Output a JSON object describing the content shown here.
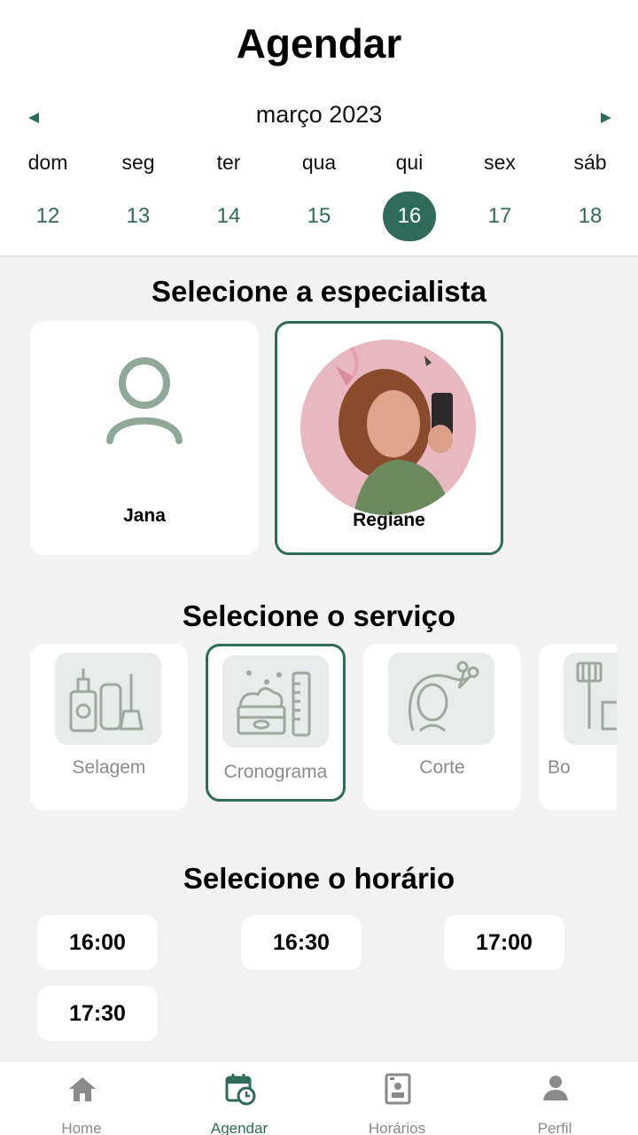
{
  "header": {
    "title": "Agendar",
    "month": "março 2023",
    "weekdays": [
      "dom",
      "seg",
      "ter",
      "qua",
      "qui",
      "sex",
      "sáb"
    ],
    "days": [
      "12",
      "13",
      "14",
      "15",
      "16",
      "17",
      "18"
    ],
    "selected_day": "16"
  },
  "specialists": {
    "title": "Selecione a especialista",
    "items": [
      {
        "name": "Jana",
        "icon": "user-outline-icon",
        "selected": false
      },
      {
        "name": "Regiane",
        "icon": "profile-photo",
        "selected": true
      }
    ]
  },
  "services": {
    "title": "Selecione o serviço",
    "items": [
      {
        "label": "Selagem",
        "icon": "hair-products-icon",
        "selected": false
      },
      {
        "label": "Cronograma",
        "icon": "cream-jar-comb-icon",
        "selected": true
      },
      {
        "label": "Corte",
        "icon": "woman-scissors-icon",
        "selected": false
      },
      {
        "label": "Bo",
        "icon": "dye-brush-icon",
        "selected": false
      }
    ]
  },
  "times": {
    "title": "Selecione o horário",
    "items": [
      "16:00",
      "16:30",
      "17:00",
      "17:30"
    ]
  },
  "nav": {
    "items": [
      {
        "label": "Home",
        "icon": "home-icon"
      },
      {
        "label": "Agendar",
        "icon": "calendar-clock-icon"
      },
      {
        "label": "Horários",
        "icon": "schedule-card-icon"
      },
      {
        "label": "Perfil",
        "icon": "person-icon"
      }
    ],
    "active": "Agendar"
  },
  "colors": {
    "accent": "#2f6b5b",
    "background": "#f2f2f2",
    "card": "#ffffff",
    "icon_tile": "#e7ebe9",
    "muted_text": "#8b8b8b"
  }
}
